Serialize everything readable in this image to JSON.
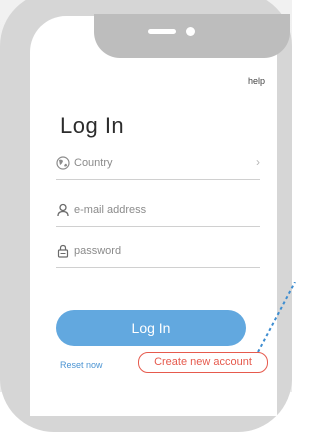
{
  "header": {
    "help_label": "help"
  },
  "page": {
    "title": "Log In"
  },
  "form": {
    "country_label": "Country",
    "email_placeholder": "e-mail address",
    "password_placeholder": "password"
  },
  "actions": {
    "login_label": "Log In",
    "reset_label": "Reset now",
    "create_label": "Create new account"
  },
  "colors": {
    "accent": "#62a8df",
    "link": "#4b94d3",
    "highlight": "#e65a4d",
    "device": "#bdbdbd"
  },
  "icons": {
    "country": "globe-icon",
    "email": "user-icon",
    "password": "lock-icon",
    "chevron": "chevron-right-icon"
  }
}
